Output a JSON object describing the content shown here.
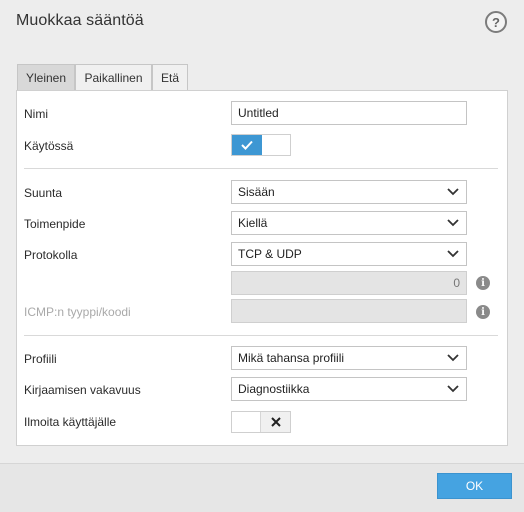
{
  "dialog": {
    "title": "Muokkaa sääntöä",
    "help_icon": "question-circle-icon"
  },
  "tabs": [
    {
      "label": "Yleinen",
      "active": true
    },
    {
      "label": "Paikallinen",
      "active": false
    },
    {
      "label": "Etä",
      "active": false
    }
  ],
  "form": {
    "name": {
      "label": "Nimi",
      "value": "Untitled"
    },
    "enabled": {
      "label": "Käytössä",
      "on": true
    },
    "direction": {
      "label": "Suunta",
      "value": "Sisään"
    },
    "action": {
      "label": "Toimenpide",
      "value": "Kiellä"
    },
    "protocol": {
      "label": "Protokolla",
      "value": "TCP & UDP"
    },
    "protocol_number": {
      "value": "0"
    },
    "icmp": {
      "label": "ICMP:n tyyppi/koodi",
      "value": ""
    },
    "profile": {
      "label": "Profiili",
      "value": "Mikä tahansa profiili"
    },
    "log_severity": {
      "label": "Kirjaamisen vakavuus",
      "value": "Diagnostiikka"
    },
    "notify_user": {
      "label": "Ilmoita käyttäjälle",
      "on": false
    }
  },
  "footer": {
    "ok_label": "OK"
  },
  "colors": {
    "accent": "#3d97d3",
    "ok_button": "#45a3e1"
  }
}
